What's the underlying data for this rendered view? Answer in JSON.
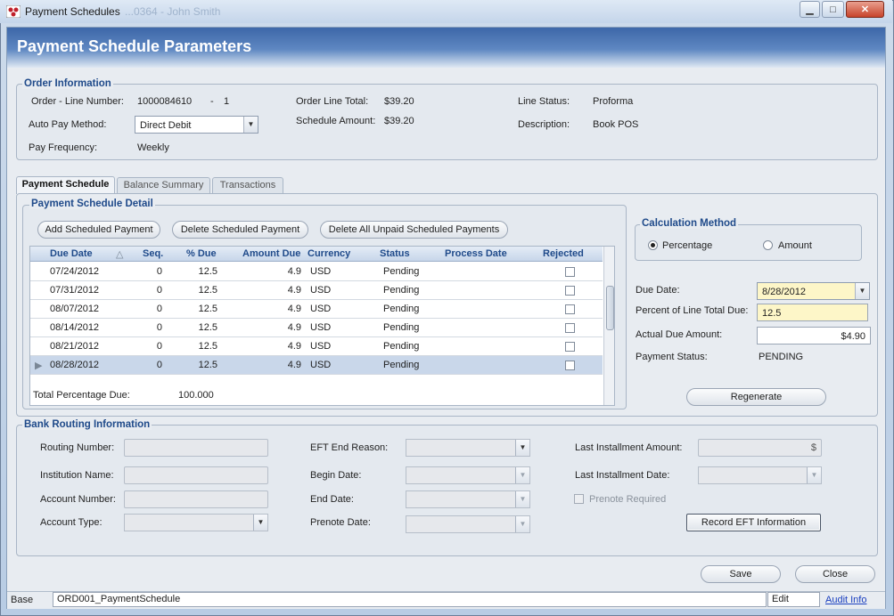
{
  "window": {
    "title": "Payment Schedules",
    "title_ghost": "...0364 - John Smith"
  },
  "header": {
    "title": "Payment Schedule Parameters"
  },
  "order_info": {
    "title": "Order Information",
    "order_line_label": "Order - Line Number:",
    "order_number": "1000084610",
    "dash": "-",
    "line_number": "1",
    "auto_pay_label": "Auto Pay Method:",
    "auto_pay_value": "Direct Debit",
    "pay_freq_label": "Pay Frequency:",
    "pay_freq_value": "Weekly",
    "line_total_label": "Order Line Total:",
    "line_total_value": "$39.20",
    "schedule_amount_label": "Schedule Amount:",
    "schedule_amount_value": "$39.20",
    "line_status_label": "Line Status:",
    "line_status_value": "Proforma",
    "description_label": "Description:",
    "description_value": "Book POS"
  },
  "tabs": [
    {
      "label": "Payment Schedule"
    },
    {
      "label": "Balance Summary"
    },
    {
      "label": "Transactions"
    }
  ],
  "detail": {
    "title": "Payment Schedule Detail",
    "add_button": "Add Scheduled Payment",
    "delete_button": "Delete Scheduled Payment",
    "delete_all_button": "Delete All Unpaid Scheduled Payments",
    "columns": [
      "Due Date",
      "Seq.",
      "% Due",
      "Amount Due",
      "Currency",
      "Status",
      "Process Date",
      "Rejected"
    ],
    "rows": [
      {
        "due": "07/24/2012",
        "seq": "0",
        "pct": "12.5",
        "amt": "4.9",
        "cur": "USD",
        "status": "Pending"
      },
      {
        "due": "07/31/2012",
        "seq": "0",
        "pct": "12.5",
        "amt": "4.9",
        "cur": "USD",
        "status": "Pending"
      },
      {
        "due": "08/07/2012",
        "seq": "0",
        "pct": "12.5",
        "amt": "4.9",
        "cur": "USD",
        "status": "Pending"
      },
      {
        "due": "08/14/2012",
        "seq": "0",
        "pct": "12.5",
        "amt": "4.9",
        "cur": "USD",
        "status": "Pending"
      },
      {
        "due": "08/21/2012",
        "seq": "0",
        "pct": "12.5",
        "amt": "4.9",
        "cur": "USD",
        "status": "Pending"
      },
      {
        "due": "08/28/2012",
        "seq": "0",
        "pct": "12.5",
        "amt": "4.9",
        "cur": "USD",
        "status": "Pending"
      }
    ],
    "total_pct_label": "Total Percentage Due:",
    "total_pct_value": "100.000"
  },
  "calc": {
    "title": "Calculation Method",
    "percentage": "Percentage",
    "amount": "Amount",
    "due_date_label": "Due Date:",
    "due_date_value": "8/28/2012",
    "pct_label": "Percent of Line Total Due:",
    "pct_value": "12.5",
    "actual_label": "Actual Due Amount:",
    "actual_value": "$4.90",
    "pay_status_label": "Payment Status:",
    "pay_status_value": "PENDING",
    "regenerate": "Regenerate"
  },
  "bank": {
    "title": "Bank Routing Information",
    "routing": "Routing Number:",
    "institution": "Institution Name:",
    "account_number": "Account Number:",
    "account_type": "Account Type:",
    "eft_end": "EFT End Reason:",
    "begin": "Begin Date:",
    "end": "End Date:",
    "prenote": "Prenote Date:",
    "last_amount": "Last Installment Amount:",
    "last_amount_value": "$",
    "last_date": "Last Installment Date:",
    "prenote_required": "Prenote Required",
    "record_eft": "Record EFT Information"
  },
  "footer": {
    "save": "Save",
    "close": "Close"
  },
  "status": {
    "base": "Base",
    "form": "ORD001_PaymentSchedule",
    "mode": "Edit",
    "audit": "Audit Info"
  }
}
